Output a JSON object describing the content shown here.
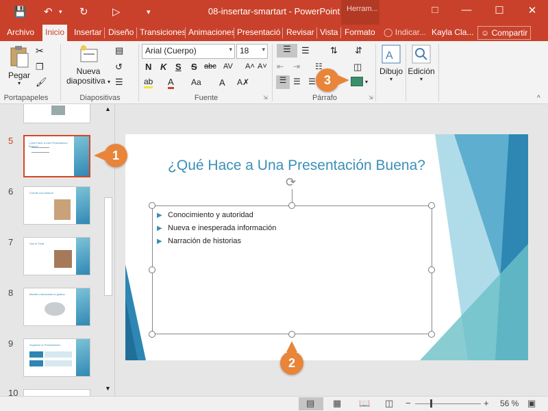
{
  "window": {
    "title": "08-insertar-smartart - PowerPoint",
    "contextual_tab_group": "Herram...",
    "qat": [
      "save-icon",
      "undo-icon",
      "redo-icon",
      "present-icon",
      "customize-icon"
    ]
  },
  "tabs": [
    {
      "label": "Archivo"
    },
    {
      "label": "Inicio"
    },
    {
      "label": "Insertar"
    },
    {
      "label": "Diseño"
    },
    {
      "label": "Transiciones"
    },
    {
      "label": "Animaciones"
    },
    {
      "label": "Presentació"
    },
    {
      "label": "Revisar"
    },
    {
      "label": "Vista"
    },
    {
      "label": "Formato"
    }
  ],
  "tell_me": "Indicar...",
  "user": "Kayla Cla...",
  "share": "Compartir",
  "ribbon": {
    "clipboard": {
      "paste": "Pegar",
      "label": "Portapapeles"
    },
    "slides": {
      "new_slide_line1": "Nueva",
      "new_slide_line2": "diapositiva",
      "label": "Diapositivas"
    },
    "font": {
      "font_name": "Arial (Cuerpo)",
      "font_size": "18",
      "label": "Fuente",
      "bold": "N",
      "italic": "K",
      "underline": "S",
      "shadow": "S",
      "strike": "abc",
      "spacing": "AV",
      "case": "Aa"
    },
    "paragraph": {
      "label": "Párrafo"
    },
    "drawing": {
      "label": "Dibujo"
    },
    "editing": {
      "label": "Edición"
    }
  },
  "thumbnails": [
    {
      "num": "5",
      "title": "¿Qué Hace a Una Presentación Buena?"
    },
    {
      "num": "6",
      "title": "Cuente una historia"
    },
    {
      "num": "7",
      "title": "Use la Tinta"
    },
    {
      "num": "8",
      "title": "Mantén interesante la gráfica"
    },
    {
      "num": "9",
      "title": "Organice la Presentación"
    },
    {
      "num": "10",
      "title": ""
    }
  ],
  "slide": {
    "title": "¿Qué Hace a Una Presentación Buena?",
    "bullets": [
      "Conocimiento y autoridad",
      "Nueva e inesperada información",
      "Narración de historias"
    ]
  },
  "callouts": [
    "1",
    "2",
    "3"
  ],
  "status": {
    "zoom": "56 %"
  }
}
